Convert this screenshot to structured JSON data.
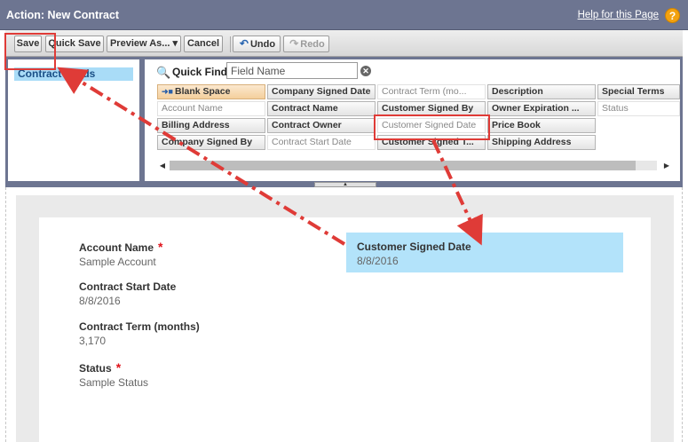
{
  "window": {
    "title": "Action: New Contract",
    "help_link": "Help for this Page",
    "help_icon": "?"
  },
  "toolbar": {
    "save": "Save",
    "quick_save": "Quick Save",
    "preview_as": "Preview As...",
    "cancel": "Cancel",
    "undo": "Undo",
    "redo": "Redo"
  },
  "sidebar": {
    "items": [
      {
        "label": "Contract Fields"
      }
    ]
  },
  "quick_find": {
    "label": "Quick Find",
    "placeholder": "Field Name"
  },
  "field_tiles": [
    {
      "label": "Blank Space",
      "state": "special"
    },
    {
      "label": "Company Signed Date",
      "state": "available"
    },
    {
      "label": "Contract Term (mo...",
      "state": "used"
    },
    {
      "label": "Description",
      "state": "available"
    },
    {
      "label": "Special Terms",
      "state": "available"
    },
    {
      "label": "Account Name",
      "state": "used"
    },
    {
      "label": "Contract Name",
      "state": "available"
    },
    {
      "label": "Customer Signed By",
      "state": "available"
    },
    {
      "label": "Owner Expiration ...",
      "state": "available"
    },
    {
      "label": "Status",
      "state": "used"
    },
    {
      "label": "Billing Address",
      "state": "available"
    },
    {
      "label": "Contract Owner",
      "state": "available"
    },
    {
      "label": "Customer Signed Date",
      "state": "used"
    },
    {
      "label": "Price Book",
      "state": "available"
    },
    {
      "label": "Company Signed By",
      "state": "available"
    },
    {
      "label": "Contract Start Date",
      "state": "used"
    },
    {
      "label": "Customer Signed T...",
      "state": "available"
    },
    {
      "label": "Shipping Address",
      "state": "available"
    }
  ],
  "layout_fields": [
    {
      "label": "Account Name",
      "value": "Sample Account",
      "required": true
    },
    {
      "label": "Contract Start Date",
      "value": "8/8/2016",
      "required": false
    },
    {
      "label": "Contract Term (months)",
      "value": "3,170",
      "required": false
    },
    {
      "label": "Status",
      "value": "Sample Status",
      "required": true
    }
  ],
  "selected_field": {
    "label": "Customer Signed Date",
    "value": "8/8/2016"
  },
  "required_marker": "*",
  "colors": {
    "header": "#6d7591",
    "selection": "#b3e3fa",
    "annotation": "#df3b37",
    "required": "#e0131b"
  }
}
